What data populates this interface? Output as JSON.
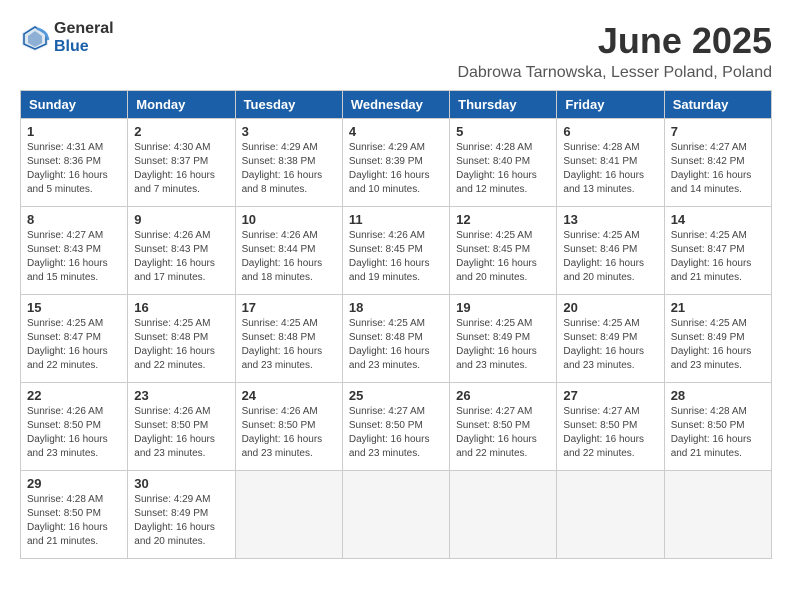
{
  "logo": {
    "general": "General",
    "blue": "Blue"
  },
  "title": "June 2025",
  "subtitle": "Dabrowa Tarnowska, Lesser Poland, Poland",
  "days_of_week": [
    "Sunday",
    "Monday",
    "Tuesday",
    "Wednesday",
    "Thursday",
    "Friday",
    "Saturday"
  ],
  "weeks": [
    [
      {
        "day": 1,
        "sunrise": "4:31 AM",
        "sunset": "8:36 PM",
        "daylight": "16 hours and 5 minutes."
      },
      {
        "day": 2,
        "sunrise": "4:30 AM",
        "sunset": "8:37 PM",
        "daylight": "16 hours and 7 minutes."
      },
      {
        "day": 3,
        "sunrise": "4:29 AM",
        "sunset": "8:38 PM",
        "daylight": "16 hours and 8 minutes."
      },
      {
        "day": 4,
        "sunrise": "4:29 AM",
        "sunset": "8:39 PM",
        "daylight": "16 hours and 10 minutes."
      },
      {
        "day": 5,
        "sunrise": "4:28 AM",
        "sunset": "8:40 PM",
        "daylight": "16 hours and 12 minutes."
      },
      {
        "day": 6,
        "sunrise": "4:28 AM",
        "sunset": "8:41 PM",
        "daylight": "16 hours and 13 minutes."
      },
      {
        "day": 7,
        "sunrise": "4:27 AM",
        "sunset": "8:42 PM",
        "daylight": "16 hours and 14 minutes."
      }
    ],
    [
      {
        "day": 8,
        "sunrise": "4:27 AM",
        "sunset": "8:43 PM",
        "daylight": "16 hours and 15 minutes."
      },
      {
        "day": 9,
        "sunrise": "4:26 AM",
        "sunset": "8:43 PM",
        "daylight": "16 hours and 17 minutes."
      },
      {
        "day": 10,
        "sunrise": "4:26 AM",
        "sunset": "8:44 PM",
        "daylight": "16 hours and 18 minutes."
      },
      {
        "day": 11,
        "sunrise": "4:26 AM",
        "sunset": "8:45 PM",
        "daylight": "16 hours and 19 minutes."
      },
      {
        "day": 12,
        "sunrise": "4:25 AM",
        "sunset": "8:45 PM",
        "daylight": "16 hours and 20 minutes."
      },
      {
        "day": 13,
        "sunrise": "4:25 AM",
        "sunset": "8:46 PM",
        "daylight": "16 hours and 20 minutes."
      },
      {
        "day": 14,
        "sunrise": "4:25 AM",
        "sunset": "8:47 PM",
        "daylight": "16 hours and 21 minutes."
      }
    ],
    [
      {
        "day": 15,
        "sunrise": "4:25 AM",
        "sunset": "8:47 PM",
        "daylight": "16 hours and 22 minutes."
      },
      {
        "day": 16,
        "sunrise": "4:25 AM",
        "sunset": "8:48 PM",
        "daylight": "16 hours and 22 minutes."
      },
      {
        "day": 17,
        "sunrise": "4:25 AM",
        "sunset": "8:48 PM",
        "daylight": "16 hours and 23 minutes."
      },
      {
        "day": 18,
        "sunrise": "4:25 AM",
        "sunset": "8:48 PM",
        "daylight": "16 hours and 23 minutes."
      },
      {
        "day": 19,
        "sunrise": "4:25 AM",
        "sunset": "8:49 PM",
        "daylight": "16 hours and 23 minutes."
      },
      {
        "day": 20,
        "sunrise": "4:25 AM",
        "sunset": "8:49 PM",
        "daylight": "16 hours and 23 minutes."
      },
      {
        "day": 21,
        "sunrise": "4:25 AM",
        "sunset": "8:49 PM",
        "daylight": "16 hours and 23 minutes."
      }
    ],
    [
      {
        "day": 22,
        "sunrise": "4:26 AM",
        "sunset": "8:50 PM",
        "daylight": "16 hours and 23 minutes."
      },
      {
        "day": 23,
        "sunrise": "4:26 AM",
        "sunset": "8:50 PM",
        "daylight": "16 hours and 23 minutes."
      },
      {
        "day": 24,
        "sunrise": "4:26 AM",
        "sunset": "8:50 PM",
        "daylight": "16 hours and 23 minutes."
      },
      {
        "day": 25,
        "sunrise": "4:27 AM",
        "sunset": "8:50 PM",
        "daylight": "16 hours and 23 minutes."
      },
      {
        "day": 26,
        "sunrise": "4:27 AM",
        "sunset": "8:50 PM",
        "daylight": "16 hours and 22 minutes."
      },
      {
        "day": 27,
        "sunrise": "4:27 AM",
        "sunset": "8:50 PM",
        "daylight": "16 hours and 22 minutes."
      },
      {
        "day": 28,
        "sunrise": "4:28 AM",
        "sunset": "8:50 PM",
        "daylight": "16 hours and 21 minutes."
      }
    ],
    [
      {
        "day": 29,
        "sunrise": "4:28 AM",
        "sunset": "8:50 PM",
        "daylight": "16 hours and 21 minutes."
      },
      {
        "day": 30,
        "sunrise": "4:29 AM",
        "sunset": "8:49 PM",
        "daylight": "16 hours and 20 minutes."
      },
      null,
      null,
      null,
      null,
      null
    ]
  ]
}
